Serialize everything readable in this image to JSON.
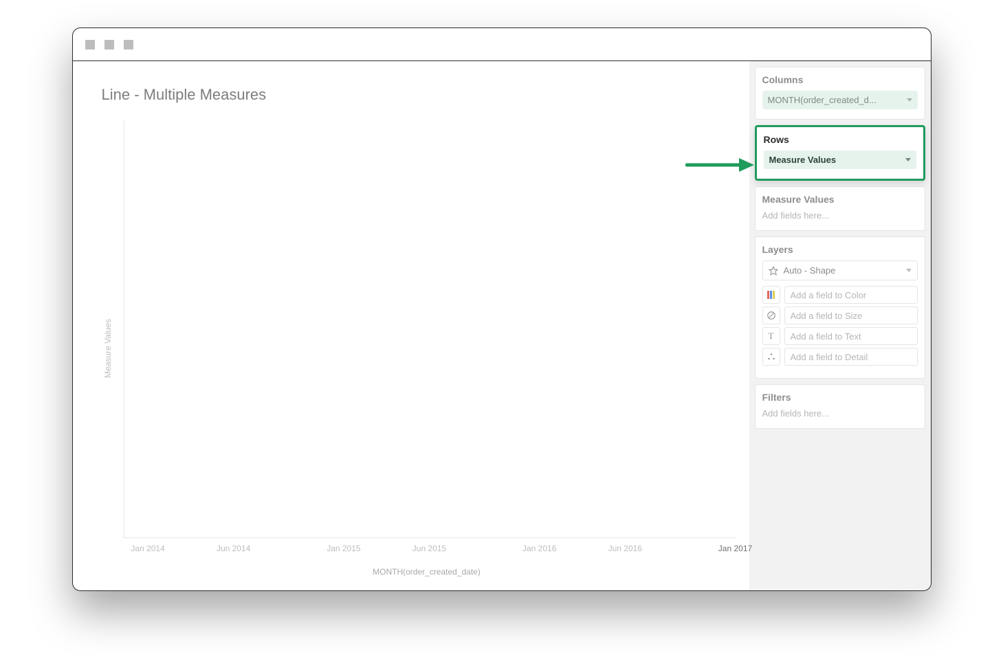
{
  "chart": {
    "title": "Line - Multiple Measures",
    "ylabel": "Measure Values",
    "xlabel": "MONTH(order_created_date)",
    "xticks": [
      {
        "label": "Jan 2014",
        "pos": 4
      },
      {
        "label": "Jun 2014",
        "pos": 18
      },
      {
        "label": "Jan 2015",
        "pos": 36
      },
      {
        "label": "Jun 2015",
        "pos": 50
      },
      {
        "label": "Jan 2016",
        "pos": 68
      },
      {
        "label": "Jun 2016",
        "pos": 82
      },
      {
        "label": "Jan 2017",
        "pos": 100
      }
    ]
  },
  "sidebar": {
    "columns": {
      "title": "Columns",
      "pill": "MONTH(order_created_d..."
    },
    "rows": {
      "title": "Rows",
      "pill": "Measure Values"
    },
    "measure_values": {
      "title": "Measure Values",
      "placeholder": "Add fields here..."
    },
    "layers": {
      "title": "Layers",
      "select_label": "Auto - Shape",
      "slots": {
        "color": "Add a field to Color",
        "size": "Add a field to Size",
        "text": "Add a field to Text",
        "detail": "Add a field to Detail"
      }
    },
    "filters": {
      "title": "Filters",
      "placeholder": "Add fields here..."
    }
  },
  "chart_data": {
    "type": "line",
    "title": "Line - Multiple Measures",
    "xlabel": "MONTH(order_created_date)",
    "ylabel": "Measure Values",
    "x": [
      "Jan 2014",
      "Jun 2014",
      "Jan 2015",
      "Jun 2015",
      "Jan 2016",
      "Jun 2016",
      "Jan 2017"
    ],
    "series": []
  }
}
